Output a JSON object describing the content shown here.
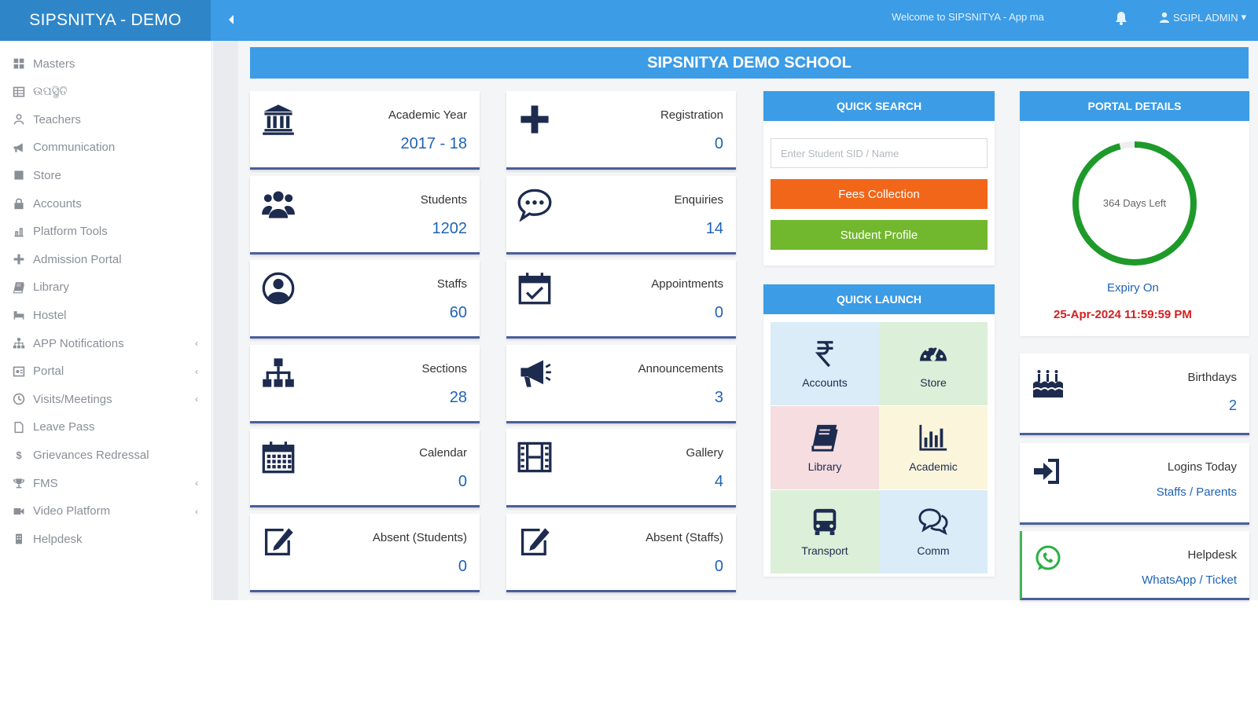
{
  "app": {
    "brand": "SIPSNITYA - DEMO"
  },
  "header": {
    "welcome": "Welcome to SIPSNITYA - App ma",
    "user": "SGIPL ADMIN"
  },
  "sidebar": {
    "items": [
      {
        "label": "Masters",
        "icon": "grid-icon",
        "has_arrow": false
      },
      {
        "label": "ଉପସ୍ଥିତି",
        "icon": "table-icon",
        "has_arrow": false
      },
      {
        "label": "Teachers",
        "icon": "user-icon",
        "has_arrow": false
      },
      {
        "label": "Communication",
        "icon": "megaphone-icon",
        "has_arrow": false
      },
      {
        "label": "Store",
        "icon": "store-icon",
        "has_arrow": false
      },
      {
        "label": "Accounts",
        "icon": "lock-icon",
        "has_arrow": false
      },
      {
        "label": "Platform Tools",
        "icon": "tools-icon",
        "has_arrow": false
      },
      {
        "label": "Admission Portal",
        "icon": "plus-icon",
        "has_arrow": false
      },
      {
        "label": "Library",
        "icon": "book-icon",
        "has_arrow": false
      },
      {
        "label": "Hostel",
        "icon": "bed-icon",
        "has_arrow": false
      },
      {
        "label": "APP Notifications",
        "icon": "sitemap-icon",
        "has_arrow": true
      },
      {
        "label": "Portal",
        "icon": "portal-icon",
        "has_arrow": true
      },
      {
        "label": "Visits/Meetings",
        "icon": "clock-icon",
        "has_arrow": true
      },
      {
        "label": "Leave Pass",
        "icon": "file-icon",
        "has_arrow": false
      },
      {
        "label": "Grievances Redressal",
        "icon": "dollar-icon",
        "has_arrow": false
      },
      {
        "label": "FMS",
        "icon": "trophy-icon",
        "has_arrow": true
      },
      {
        "label": "Video Platform",
        "icon": "video-icon",
        "has_arrow": true
      },
      {
        "label": "Helpdesk",
        "icon": "building-icon",
        "has_arrow": false
      }
    ]
  },
  "main": {
    "school_name": "SIPSNITYA DEMO SCHOOL",
    "cards_left": [
      {
        "label": "Academic Year",
        "value": "2017 - 18",
        "icon": "institution-icon"
      },
      {
        "label": "Students",
        "value": "1202",
        "icon": "users-icon"
      },
      {
        "label": "Staffs",
        "value": "60",
        "icon": "user-circle-icon"
      },
      {
        "label": "Sections",
        "value": "28",
        "icon": "sitemap-icon"
      },
      {
        "label": "Calendar",
        "value": "0",
        "icon": "calendar-icon"
      },
      {
        "label": "Absent (Students)",
        "value": "0",
        "icon": "edit-icon"
      }
    ],
    "cards_right": [
      {
        "label": "Registration",
        "value": "0",
        "icon": "plus-icon"
      },
      {
        "label": "Enquiries",
        "value": "14",
        "icon": "chat-icon"
      },
      {
        "label": "Appointments",
        "value": "0",
        "icon": "calendar-check-icon"
      },
      {
        "label": "Announcements",
        "value": "3",
        "icon": "bullhorn-icon"
      },
      {
        "label": "Gallery",
        "value": "4",
        "icon": "film-icon"
      },
      {
        "label": "Absent (Staffs)",
        "value": "0",
        "icon": "edit-icon"
      }
    ]
  },
  "quick_search": {
    "title": "QUICK SEARCH",
    "placeholder": "Enter Student SID / Name",
    "btn_fees": "Fees Collection",
    "btn_profile": "Student Profile"
  },
  "quick_launch": {
    "title": "QUICK LAUNCH",
    "tiles": [
      {
        "label": "Accounts",
        "icon": "rupee-icon",
        "bg": "#d9ecf7"
      },
      {
        "label": "Store",
        "icon": "dashboard-icon",
        "bg": "#dcefd8"
      },
      {
        "label": "Library",
        "icon": "book-icon",
        "bg": "#f5dde0"
      },
      {
        "label": "Academic",
        "icon": "bar-chart-icon",
        "bg": "#fbf5dc"
      },
      {
        "label": "Transport",
        "icon": "bus-icon",
        "bg": "#dcefd8"
      },
      {
        "label": "Comm",
        "icon": "comments-icon",
        "bg": "#d9ecf7"
      }
    ]
  },
  "portal": {
    "title": "PORTAL DETAILS",
    "days_left": "364 Days Left",
    "days_progress": 0.96,
    "expiry_label": "Expiry On",
    "expiry_date": "25-Apr-2024 11:59:59 PM"
  },
  "side_cards": {
    "birthdays": {
      "label": "Birthdays",
      "value": "2"
    },
    "logins": {
      "label": "Logins Today",
      "link1": "Staffs",
      "sep": " / ",
      "link2": "Parents"
    },
    "helpdesk": {
      "label": "Helpdesk",
      "link1": "WhatsApp",
      "sep": " / ",
      "link2": "Ticket"
    }
  },
  "colors": {
    "primary": "#3c9ce6",
    "brand_bg": "#2e86c9",
    "value_blue": "#1f63b5",
    "orange": "#f2661a",
    "green": "#72b82e",
    "ring_green": "#1e9a2a",
    "expiry_red": "#d32020"
  }
}
